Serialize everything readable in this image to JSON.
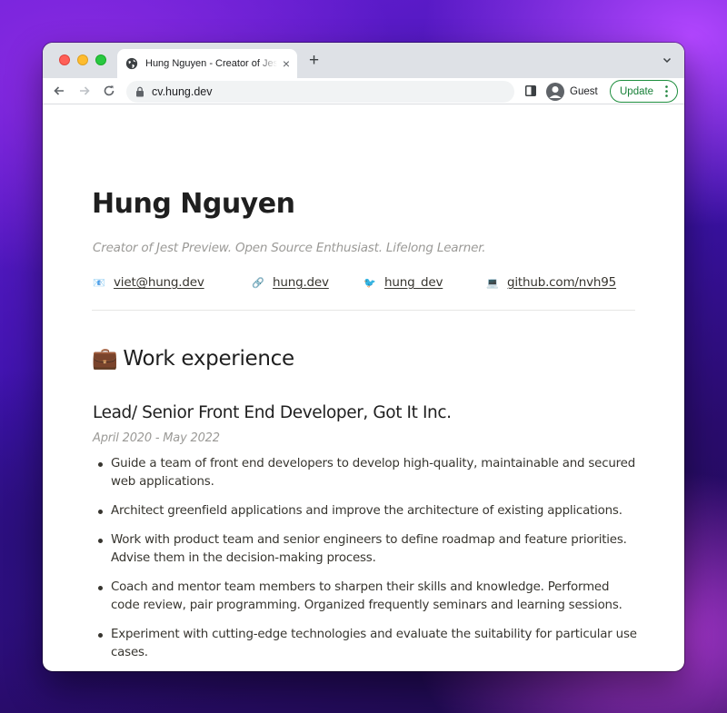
{
  "browser": {
    "tab_title": "Hung Nguyen - Creator of Jest Preview",
    "tab_close": "×",
    "new_tab": "+",
    "url": "cv.hung.dev",
    "profile_label": "Guest",
    "update_label": "Update"
  },
  "profile": {
    "name": "Hung Nguyen",
    "tagline": "Creator of Jest Preview. Open Source Enthusiast. Lifelong Learner."
  },
  "contacts": [
    {
      "icon": "📧",
      "icon_name": "email-icon",
      "text": "viet@hung.dev"
    },
    {
      "icon": "🔗",
      "icon_name": "link-icon",
      "text": "hung.dev"
    },
    {
      "icon": "🐦",
      "icon_name": "twitter-bird-icon",
      "text": "hung_dev"
    },
    {
      "icon": "💻",
      "icon_name": "laptop-icon",
      "text": "github.com/nvh95"
    }
  ],
  "work": {
    "section_emoji": "💼",
    "section_title": "Work experience",
    "jobs": [
      {
        "title": "Lead/ Senior Front End Developer, Got It Inc.",
        "dates": "April 2020 - May 2022",
        "duties": [
          "Guide a team of front end developers to develop high-quality, maintainable and secured web applications.",
          "Architect greenfield applications and improve the architecture of existing applications.",
          "Work with product team and senior engineers to define roadmap and feature priorities. Advise them in the decision-making process.",
          "Coach and mentor team members to sharpen their skills and knowledge. Performed code review, pair programming. Organized frequently seminars and learning sessions.",
          "Experiment with cutting-edge technologies and evaluate the suitability for particular use cases."
        ]
      }
    ]
  },
  "colors": {
    "accent_update": "#188038",
    "text": "#37352f",
    "muted": "#9b9a97"
  }
}
